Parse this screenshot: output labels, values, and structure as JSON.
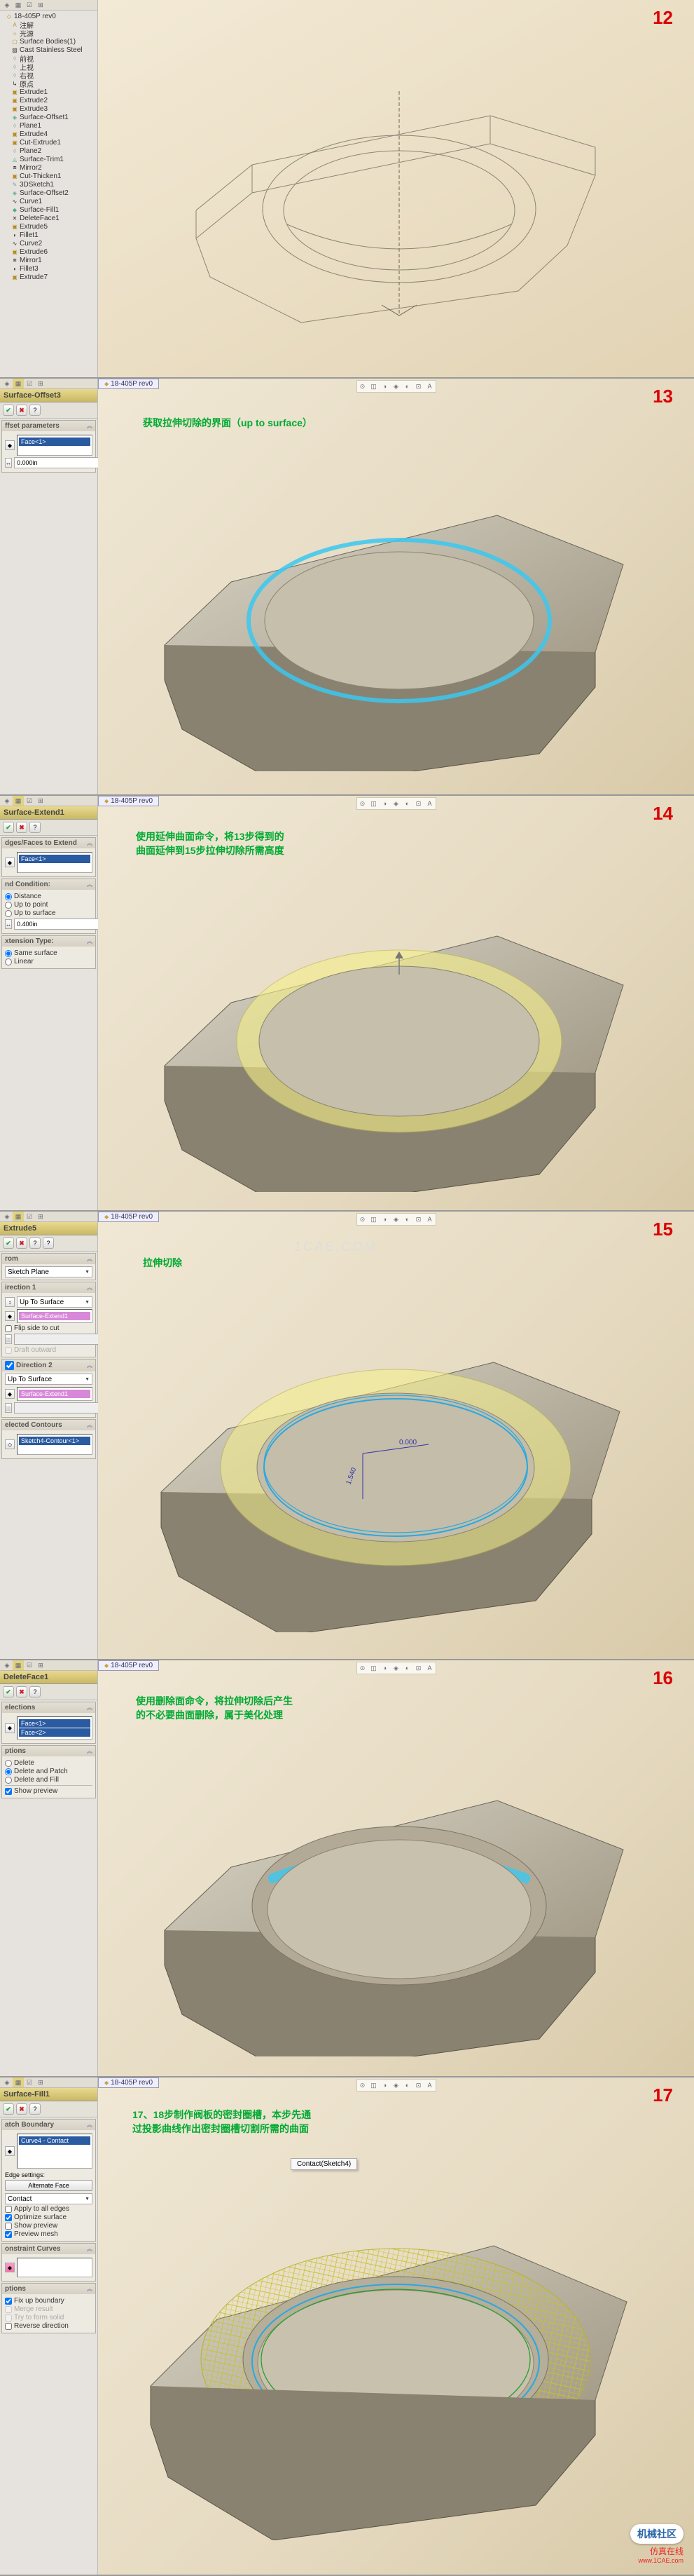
{
  "file_tab": "18-405P rev0",
  "steps": {
    "s12": {
      "num": "12"
    },
    "s13": {
      "num": "13",
      "caption": "获取拉伸切除的界面（up to surface）"
    },
    "s14": {
      "num": "14",
      "caption": "使用延伸曲面命令，将13步得到的\n曲面延伸到15步拉伸切除所需高度"
    },
    "s15": {
      "num": "15",
      "caption": "拉伸切除"
    },
    "s16": {
      "num": "16",
      "caption": "使用删除面命令，将拉伸切除后产生\n的不必要曲面删除，属于美化处理"
    },
    "s17": {
      "num": "17",
      "caption": "17、18步制作阀板的密封圈槽，本步先通\n过投影曲线作出密封圈槽切割所需的曲面"
    }
  },
  "tree": {
    "root": "18-405P rev0",
    "nodes": [
      "注解",
      "光源",
      "Surface Bodies(1)",
      "Cast Stainless Steel",
      "前视",
      "上视",
      "右视",
      "原点",
      "Extrude1",
      "Extrude2",
      "Extrude3",
      "Surface-Offset1",
      "Plane1",
      "Extrude4",
      "Cut-Extrude1",
      "Plane2",
      "Surface-Trim1",
      "Mirror2",
      "Cut-Thicken1",
      "3DSketch1",
      "Surface-Offset2",
      "Curve1",
      "Surface-Fill1",
      "DeleteFace1",
      "Extrude5",
      "Fillet1",
      "Curve2",
      "Extrude6",
      "Mirror1",
      "Fillet3",
      "Extrude7"
    ]
  },
  "pm13": {
    "title": "Surface-Offset3",
    "group_params": "ffset parameters",
    "sel": "Face<1>",
    "dist": "0.000in"
  },
  "pm14": {
    "title": "Surface-Extend1",
    "group_faces": "dges/Faces to Extend",
    "sel": "Face<1>",
    "group_cond": "nd Condition:",
    "r1": "Distance",
    "r2": "Up to point",
    "r3": "Up to surface",
    "dist": "0.400in",
    "group_ext": "xtension Type:",
    "r4": "Same surface",
    "r5": "Linear"
  },
  "pm15": {
    "title": "Extrude5",
    "grp_from": "rom",
    "from_opt": "Sketch Plane",
    "grp_dir1": "irection 1",
    "dir1_opt": "Up To Surface",
    "dir1_sel": "Surface-Extend1",
    "flip": "Flip side to cut",
    "draft": "Draft outward",
    "grp_dir2": "Direction 2",
    "dir2_opt": "Up To Surface",
    "dir2_sel": "Surface-Extend1",
    "grp_contours": "elected Contours",
    "contour": "Sketch4-Contour<1>",
    "dim1": "0.000",
    "dim2": "1.540"
  },
  "pm16": {
    "title": "DeleteFace1",
    "grp_sel": "elections",
    "sel1": "Face<1>",
    "sel2": "Face<2>",
    "grp_opt": "ptions",
    "o1": "Delete",
    "o2": "Delete and Patch",
    "o3": "Delete and Fill",
    "preview": "Show preview"
  },
  "pm17": {
    "title": "Surface-Fill1",
    "grp_patch": "atch Boundary",
    "sel": "Curve4 - Contact",
    "edge_lbl": "Edge settings:",
    "edge_btn": "Alternate Face",
    "edge_opt": "Contact",
    "c1": "Apply to all edges",
    "c2": "Optimize surface",
    "c3": "Show preview",
    "c4": "Preview mesh",
    "grp_constraint": "onstraint Curves",
    "grp_opts": "ptions",
    "oo1": "Fix up boundary",
    "oo2": "Merge result",
    "oo3": "Try to form solid",
    "oo4": "Reverse direction",
    "ctxmenu": "Contact(Sketch4)"
  },
  "watermark1": "机械社区",
  "watermark2": "仿真在线",
  "watermark3": "www.1CAE.com"
}
